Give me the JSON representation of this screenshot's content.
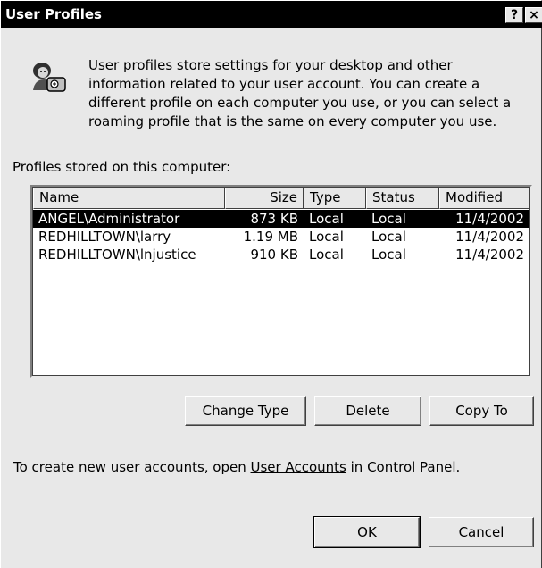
{
  "window": {
    "title": "User Profiles",
    "help_label": "?",
    "close_label": "×"
  },
  "info": {
    "icon": "user-profile-icon",
    "text": "User profiles store settings for your desktop and other information related to your user account. You can create a different profile on each computer you use, or you can select a roaming profile that is the same on every computer you use."
  },
  "profiles": {
    "label": "Profiles stored on this computer:",
    "columns": {
      "name": "Name",
      "size": "Size",
      "type": "Type",
      "status": "Status",
      "modified": "Modified"
    },
    "rows": [
      {
        "name": "ANGEL\\Administrator",
        "size": "873 KB",
        "type": "Local",
        "status": "Local",
        "modified": "11/4/2002",
        "selected": true
      },
      {
        "name": "REDHILLTOWN\\larry",
        "size": "1.19 MB",
        "type": "Local",
        "status": "Local",
        "modified": "11/4/2002",
        "selected": false
      },
      {
        "name": "REDHILLTOWN\\lnjustice",
        "size": "910 KB",
        "type": "Local",
        "status": "Local",
        "modified": "11/4/2002",
        "selected": false
      }
    ]
  },
  "actions": {
    "change_type": "Change Type",
    "delete": "Delete",
    "copy_to": "Copy To"
  },
  "footer": {
    "before": "To create new user accounts, open ",
    "link": "User Accounts",
    "after": " in Control Panel."
  },
  "dialog_buttons": {
    "ok": "OK",
    "cancel": "Cancel"
  }
}
